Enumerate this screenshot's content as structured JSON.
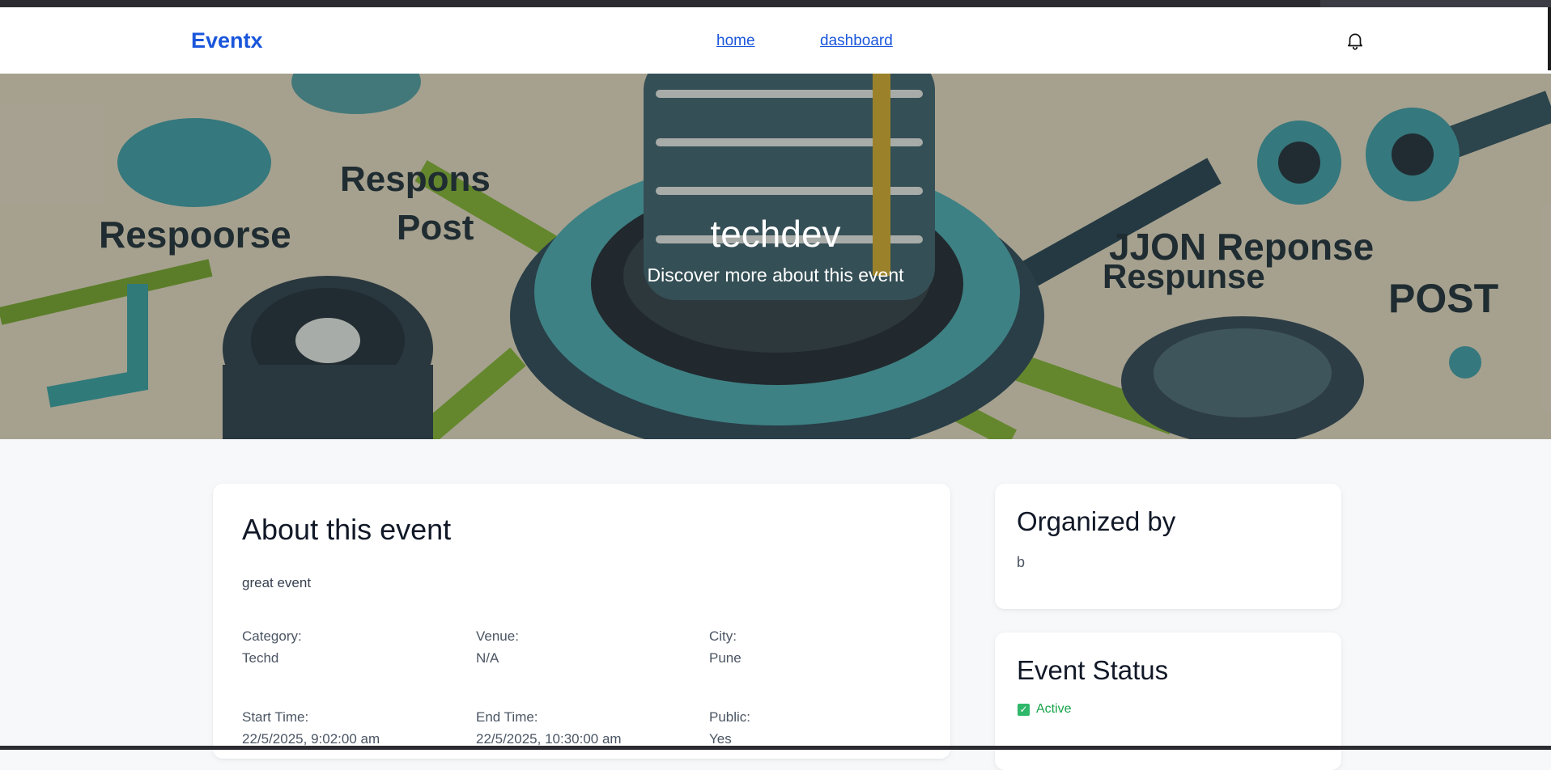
{
  "nav": {
    "brand": "Eventx",
    "links": [
      "home",
      "dashboard"
    ],
    "bell_icon": "bell-icon"
  },
  "hero": {
    "title": "techdev",
    "subtitle": "Discover more about this event",
    "artwork_text": [
      "Respons",
      "Post",
      "Respoorse",
      "JJON Reponse",
      "Respunse",
      "POST"
    ]
  },
  "about": {
    "heading": "About this event",
    "description": "great event",
    "fields": [
      {
        "label": "Category:",
        "value": "Techd"
      },
      {
        "label": "Venue:",
        "value": "N/A"
      },
      {
        "label": "City:",
        "value": "Pune"
      },
      {
        "label": "Start Time:",
        "value": "22/5/2025, 9:02:00 am"
      },
      {
        "label": "End Time:",
        "value": "22/5/2025, 10:30:00 am"
      },
      {
        "label": "Public:",
        "value": "Yes"
      }
    ]
  },
  "organizer": {
    "heading": "Organized by",
    "name": "b"
  },
  "status": {
    "heading": "Event Status",
    "value": "Active",
    "icon": "checkbox-checked-icon",
    "color": "#16a34a"
  },
  "colors": {
    "brand": "#1a56db",
    "page_bg": "#f6f8fa"
  }
}
